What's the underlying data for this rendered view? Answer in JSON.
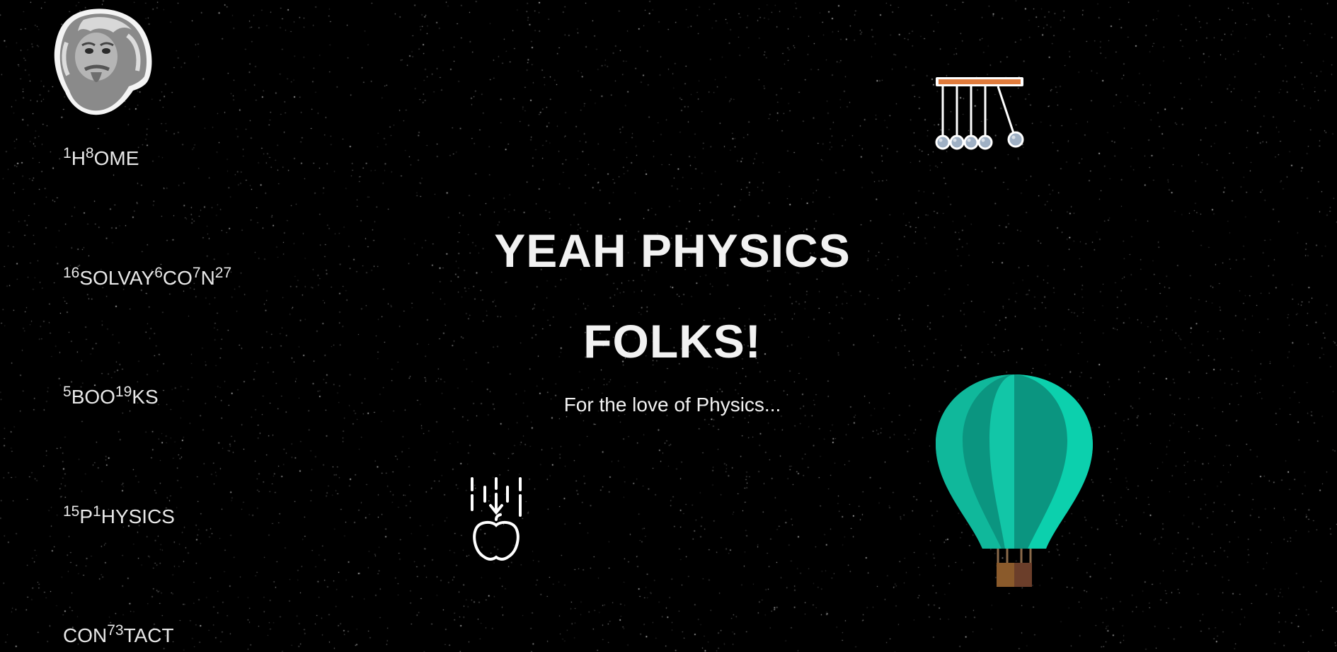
{
  "nav": {
    "home": [
      {
        "sup": "1",
        "text": "H"
      },
      {
        "sup": "8",
        "text": "OME"
      }
    ],
    "solvay": [
      {
        "sup": "16",
        "text": "SOLVAY"
      },
      {
        "sup": "6",
        "text": "CO"
      },
      {
        "sup": "7",
        "text": "N"
      },
      {
        "sup": "27",
        "text": ""
      }
    ],
    "books": [
      {
        "sup": "5",
        "text": "BOO"
      },
      {
        "sup": "19",
        "text": "KS"
      }
    ],
    "physics": [
      {
        "sup": "15",
        "text": "P"
      },
      {
        "sup": "1",
        "text": "HYSICS"
      }
    ],
    "contact": [
      {
        "sup": "",
        "text": "CON"
      },
      {
        "sup": "73",
        "text": "TACT"
      }
    ]
  },
  "hero": {
    "title": "YEAH PHYSICS FOLKS!",
    "subtitle": "For the love of Physics..."
  },
  "images": {
    "einstein": "einstein-portrait",
    "cradle": "newtons-cradle-icon",
    "apple": "falling-apple-icon",
    "balloon": "hot-air-balloon-icon"
  },
  "colors": {
    "background": "#000000",
    "text": "#e8e8e8",
    "balloon_light": "#10c4a8",
    "balloon_dark": "#0b9580",
    "basket": "#8a5a2b",
    "cradle_bar": "#e07b3c"
  }
}
